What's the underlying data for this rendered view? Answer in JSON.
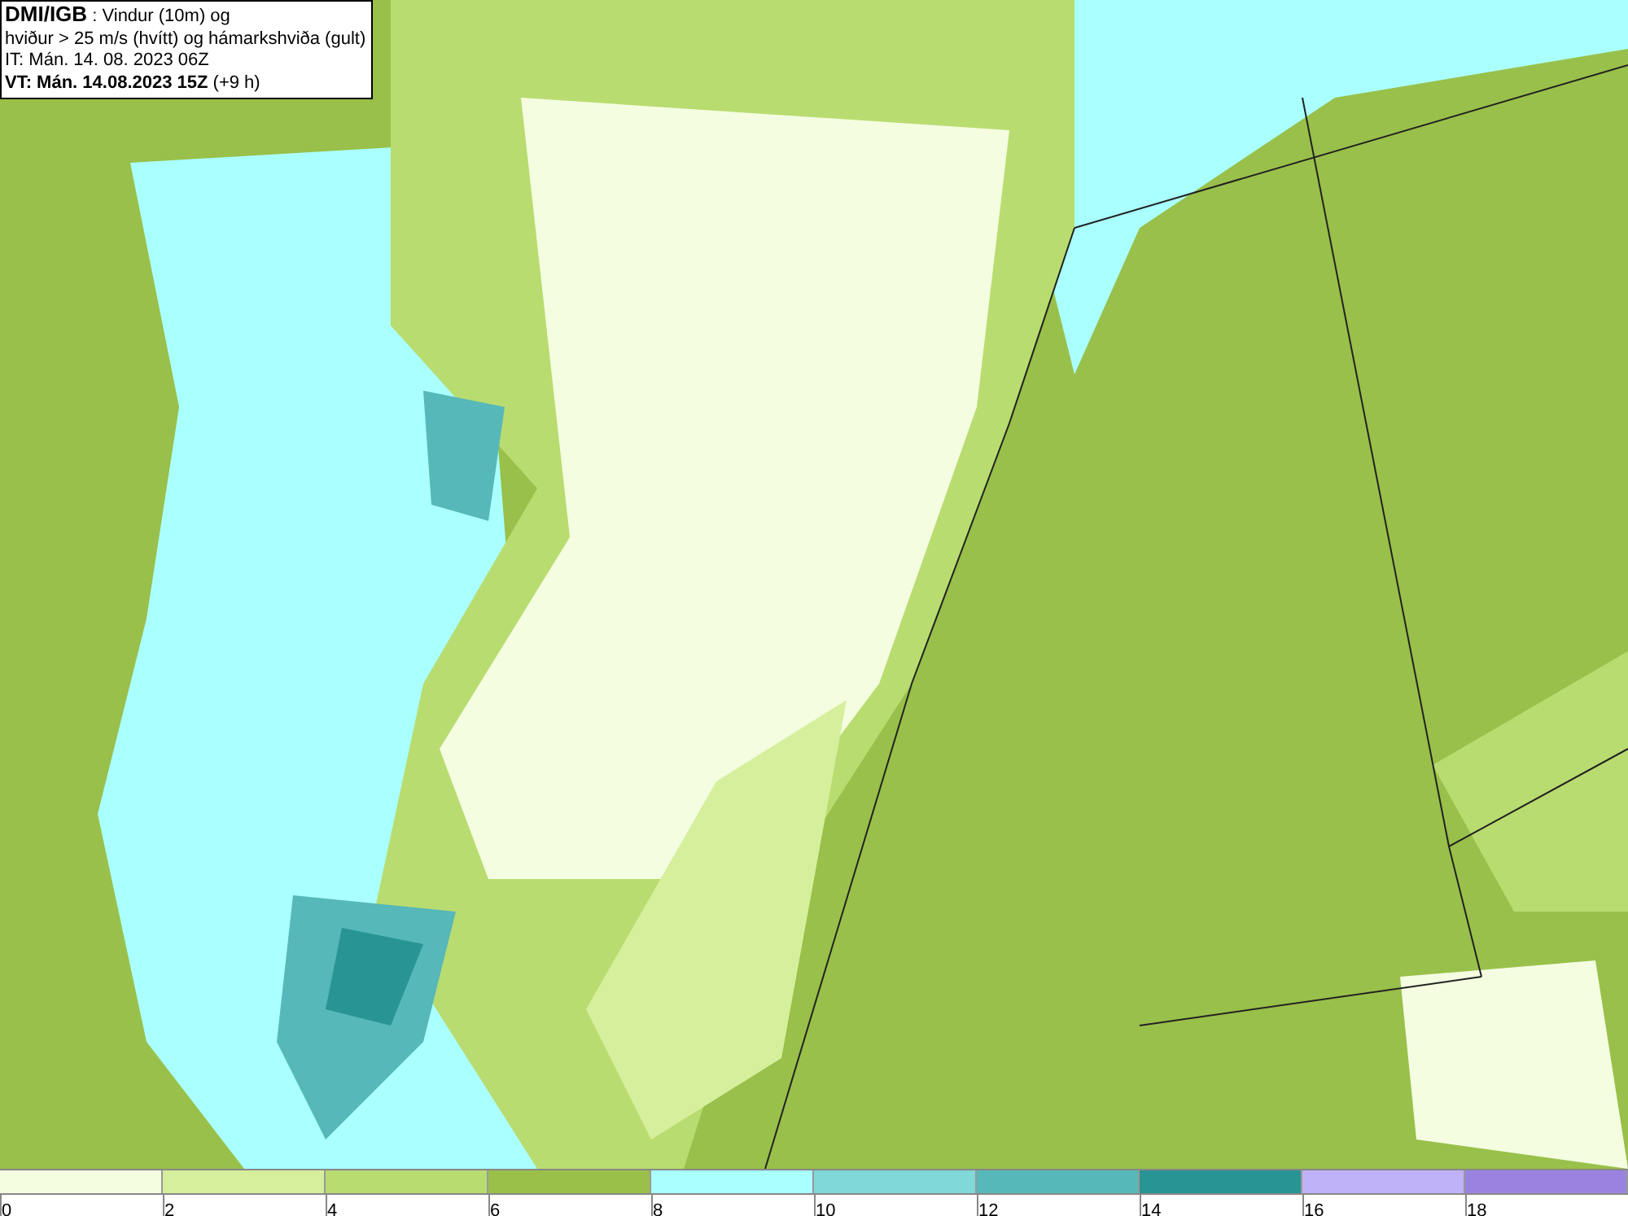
{
  "legend": {
    "lines": [
      "**DMI/IGB** : Vindur (10m) og",
      "hviður > 25 m/s (hvítt) og hámarkshviða (gult)",
      "IT: Mán. 14. 08. 2023 06Z",
      "**VT: Mán. 14.08.2023 15Z** (+9 h)"
    ]
  },
  "colorbar": {
    "segments": [
      {
        "color": "#f4fde0"
      },
      {
        "color": "#d6ef9c"
      },
      {
        "color": "#b9dc70"
      },
      {
        "color": "#9ac04a"
      },
      {
        "color": "#aaffff"
      },
      {
        "color": "#80d8d8"
      },
      {
        "color": "#56b8b8"
      },
      {
        "color": "#289494"
      },
      {
        "color": "#c0b2f8"
      },
      {
        "color": "#9a82e0"
      }
    ],
    "ticks": [
      "0",
      "2",
      "4",
      "6",
      "8",
      "10",
      "12",
      "14",
      "16",
      "18"
    ]
  }
}
